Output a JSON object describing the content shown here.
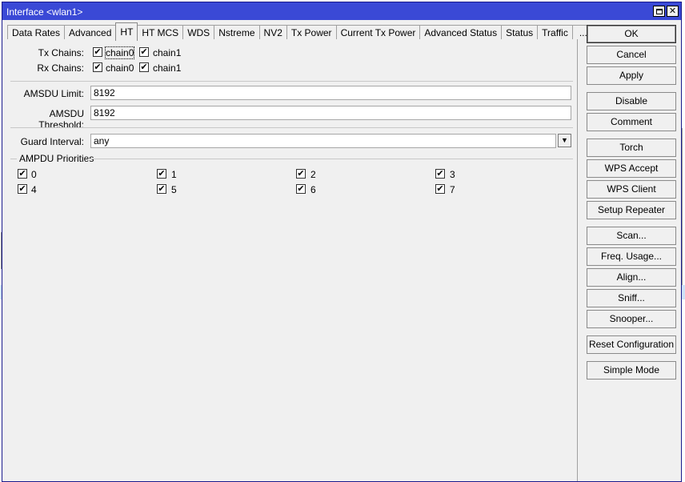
{
  "window": {
    "title": "Interface <wlan1>"
  },
  "tabs": [
    {
      "label": "Data Rates"
    },
    {
      "label": "Advanced"
    },
    {
      "label": "HT"
    },
    {
      "label": "HT MCS"
    },
    {
      "label": "WDS"
    },
    {
      "label": "Nstreme"
    },
    {
      "label": "NV2"
    },
    {
      "label": "Tx Power"
    },
    {
      "label": "Current Tx Power"
    },
    {
      "label": "Advanced Status"
    },
    {
      "label": "Status"
    },
    {
      "label": "Traffic"
    },
    {
      "label": "..."
    }
  ],
  "active_tab": "HT",
  "ht": {
    "tx_chains": {
      "label": "Tx Chains:",
      "chain0": "chain0",
      "chain1": "chain1",
      "chain0_checked": true,
      "chain1_checked": true
    },
    "rx_chains": {
      "label": "Rx Chains:",
      "chain0": "chain0",
      "chain1": "chain1",
      "chain0_checked": true,
      "chain1_checked": true
    },
    "amsdu_limit": {
      "label": "AMSDU Limit:",
      "value": "8192"
    },
    "amsdu_threshold": {
      "label": "AMSDU Threshold:",
      "value": "8192"
    },
    "guard_interval": {
      "label": "Guard Interval:",
      "value": "any"
    },
    "ampdu_priorities": {
      "label": "AMPDU Priorities",
      "items": [
        {
          "label": "0",
          "checked": true
        },
        {
          "label": "1",
          "checked": true
        },
        {
          "label": "2",
          "checked": true
        },
        {
          "label": "3",
          "checked": true
        },
        {
          "label": "4",
          "checked": true
        },
        {
          "label": "5",
          "checked": true
        },
        {
          "label": "6",
          "checked": true
        },
        {
          "label": "7",
          "checked": true
        }
      ]
    }
  },
  "buttons": {
    "ok": "OK",
    "cancel": "Cancel",
    "apply": "Apply",
    "disable": "Disable",
    "comment": "Comment",
    "torch": "Torch",
    "wps_accept": "WPS Accept",
    "wps_client": "WPS Client",
    "setup_repeater": "Setup Repeater",
    "scan": "Scan...",
    "freq_usage": "Freq. Usage...",
    "align": "Align...",
    "sniff": "Sniff...",
    "snooper": "Snooper...",
    "reset_configuration": "Reset Configuration",
    "simple_mode": "Simple Mode"
  },
  "icons": {
    "check": "✔",
    "dropdown": "▼",
    "close": "✕"
  }
}
